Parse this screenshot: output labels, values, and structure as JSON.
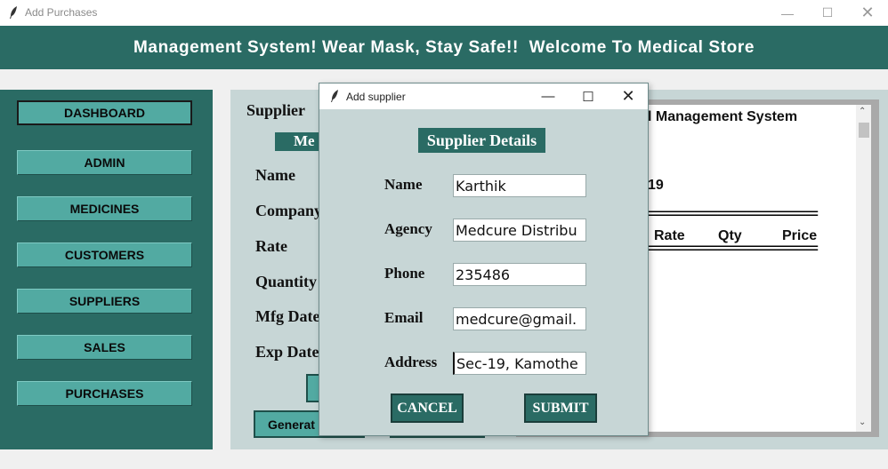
{
  "window": {
    "title": "Add Purchases",
    "controls": [
      "minimize",
      "maximize",
      "close"
    ]
  },
  "banner": {
    "text": "Management System! Wear Mask, Stay Safe!!  Welcome To Medical Store"
  },
  "sidebar": {
    "items": [
      {
        "label": "DASHBOARD"
      },
      {
        "label": "ADMIN"
      },
      {
        "label": "MEDICINES"
      },
      {
        "label": "CUSTOMERS"
      },
      {
        "label": "SUPPLIERS"
      },
      {
        "label": "SALES"
      },
      {
        "label": "PURCHASES"
      }
    ]
  },
  "form": {
    "heading": "Supplier",
    "tag": "Me",
    "labels": [
      "Name",
      "Company",
      "Rate",
      "Quantity",
      "Mfg Date",
      "Exp Date"
    ],
    "generate_button": "Generat"
  },
  "bill": {
    "line1": "l Management System",
    "line2": "19",
    "separator": "==============================",
    "columns": [
      "Rate",
      "Qty",
      "Price"
    ]
  },
  "dialog": {
    "title": "Add supplier",
    "header": "Supplier Details",
    "fields": [
      {
        "label": "Name",
        "value": "Karthik"
      },
      {
        "label": "Agency",
        "value": "Medcure Distribu"
      },
      {
        "label": "Phone",
        "value": "235486"
      },
      {
        "label": "Email",
        "value": "medcure@gmail."
      },
      {
        "label": "Address",
        "value": "Sec-19, Kamothe"
      }
    ],
    "cancel_label": "CANCEL",
    "submit_label": "SUBMIT"
  },
  "colors": {
    "teal_dark": "#2a6b64",
    "teal_button": "#52aaa2",
    "panel_bg": "#c7d6d6"
  }
}
